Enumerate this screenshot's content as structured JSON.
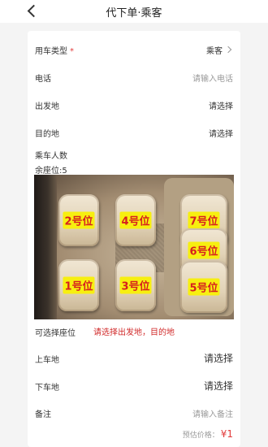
{
  "header": {
    "title": "代下单·乘客"
  },
  "form": {
    "car_type": {
      "label": "用车类型",
      "required_mark": "*",
      "value": "乘客"
    },
    "phone": {
      "label": "电话",
      "placeholder": "请输入电话"
    },
    "departure": {
      "label": "出发地",
      "value": "请选择"
    },
    "destination": {
      "label": "目的地",
      "value": "请选择"
    },
    "passengers": {
      "label": "乘车人数"
    },
    "remaining": {
      "label": "余座位:5"
    },
    "seats": [
      {
        "label": "2号位"
      },
      {
        "label": "4号位"
      },
      {
        "label": "7号位"
      },
      {
        "label": "6号位"
      },
      {
        "label": "1号位"
      },
      {
        "label": "3号位"
      },
      {
        "label": "5号位"
      }
    ],
    "selectable_seats": {
      "label": "可选择座位",
      "hint": "请选择出发地，目的地"
    },
    "boarding": {
      "label": "上车地",
      "value": "请选择"
    },
    "alighting": {
      "label": "下车地",
      "value": "请选择"
    },
    "remark": {
      "label": "备注",
      "placeholder": "请输入备注"
    },
    "price": {
      "label": "预估价格：",
      "amount": "¥1"
    }
  },
  "colors": {
    "accent_red": "#e23b3b",
    "seat_label_bg": "#f7ef10",
    "seat_label_text": "#d61f1f"
  }
}
